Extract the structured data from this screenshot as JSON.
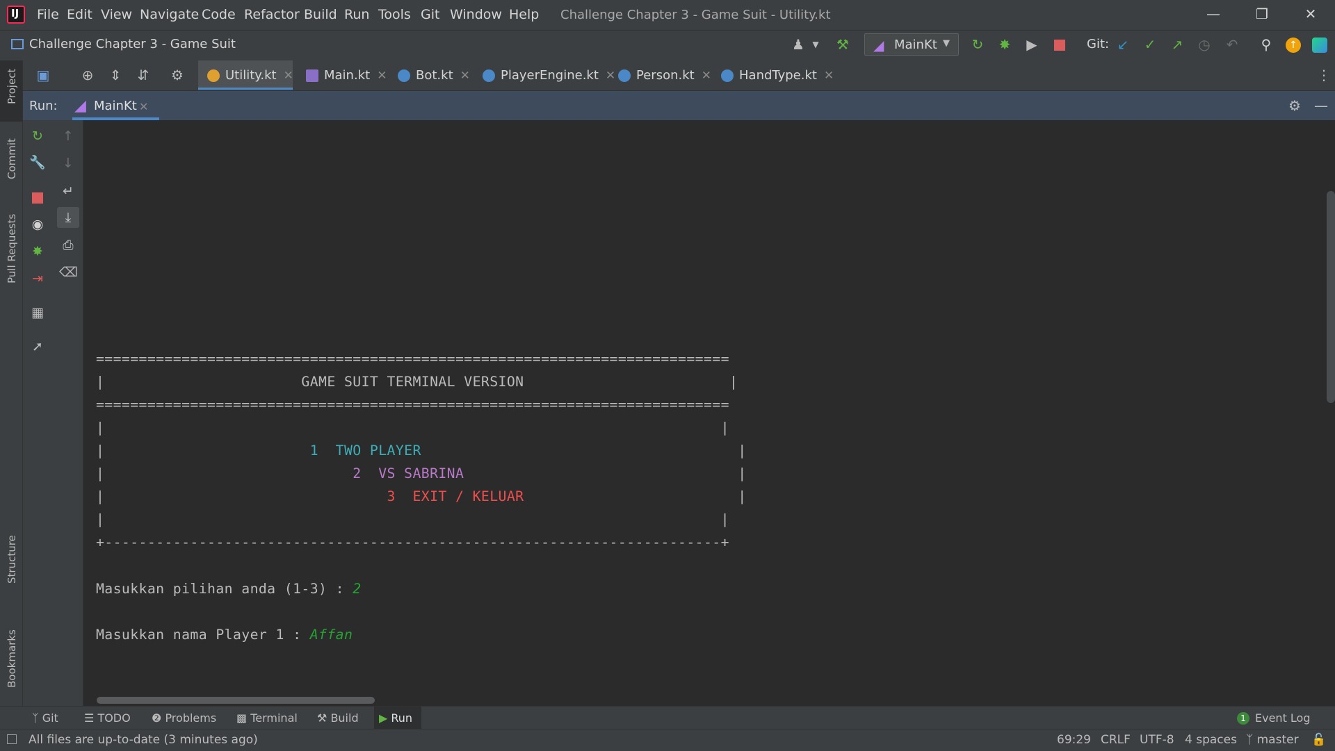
{
  "window": {
    "title": "Challenge Chapter 3 - Game Suit - Utility.kt",
    "menu": [
      "File",
      "Edit",
      "View",
      "Navigate",
      "Code",
      "Refactor",
      "Build",
      "Run",
      "Tools",
      "Git",
      "Window",
      "Help"
    ],
    "logo_text": "IJ"
  },
  "navbar": {
    "project": "Challenge Chapter 3 - Game Suit",
    "run_config": "MainKt",
    "git_label": "Git:"
  },
  "left_stripe": [
    "Project",
    "Commit",
    "Pull Requests",
    "Structure",
    "Bookmarks"
  ],
  "editor_tabs": [
    {
      "label": "Utility.kt",
      "active": true
    },
    {
      "label": "Main.kt",
      "active": false
    },
    {
      "label": "Bot.kt",
      "active": false
    },
    {
      "label": "PlayerEngine.kt",
      "active": false
    },
    {
      "label": "Person.kt",
      "active": false
    },
    {
      "label": "HandType.kt",
      "active": false
    }
  ],
  "run_window": {
    "label": "Run:",
    "tab": "MainKt"
  },
  "console": {
    "border_eq": "==========================================================================",
    "title_line": "|                       GAME SUIT TERMINAL VERSION                        |",
    "empty_line": "|                                                                        |",
    "opt1_prefix": "|                        ",
    "opt1": "1  TWO PLAYER",
    "opt1_suffix": "                                     |",
    "opt2_prefix": "|                             ",
    "opt2": "2  VS SABRINA",
    "opt2_suffix": "                                |",
    "opt3_prefix": "|                                 ",
    "opt3": "3  EXIT / KELUAR",
    "opt3_suffix": "                         |",
    "bottom_border": "+------------------------------------------------------------------------+",
    "prompt1": "Masukkan pilihan anda (1-3) : ",
    "input1": "2",
    "prompt2": "Masukkan nama Player 1 : ",
    "input2": "Affan",
    "colors": {
      "opt1": "#3dadb8",
      "opt2": "#b779c8",
      "opt3": "#f24d4d",
      "input": "#27a334"
    }
  },
  "bottom_tabs": [
    "Git",
    "TODO",
    "Problems",
    "Terminal",
    "Build",
    "Run"
  ],
  "event_log": {
    "label": "Event Log",
    "count": "1"
  },
  "status": {
    "message": "All files are up-to-date (3 minutes ago)",
    "position": "69:29",
    "line_sep": "CRLF",
    "encoding": "UTF-8",
    "indent": "4 spaces",
    "branch": "master"
  }
}
